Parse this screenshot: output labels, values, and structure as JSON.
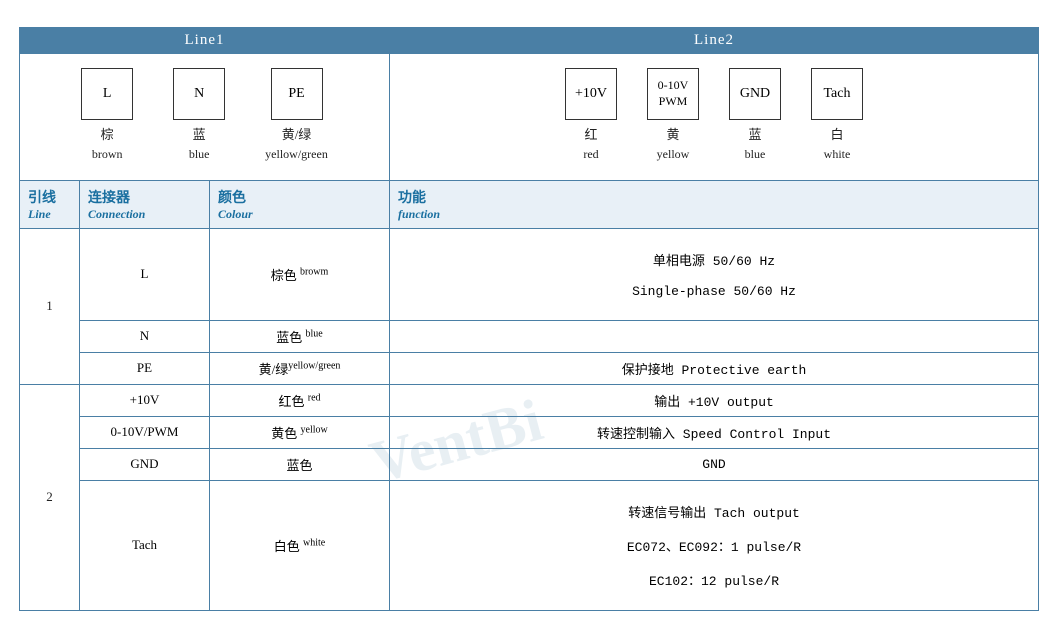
{
  "header": {
    "line1_label": "Line1",
    "line2_label": "Line2"
  },
  "diagram": {
    "line1": [
      {
        "symbol": "L",
        "cn": "棕",
        "en": "brown"
      },
      {
        "symbol": "N",
        "cn": "蓝",
        "en": "blue"
      },
      {
        "symbol": "PE",
        "cn": "黄/绿",
        "en": "yellow/green"
      }
    ],
    "line2": [
      {
        "symbol": "+10V",
        "cn": "红",
        "en": "red"
      },
      {
        "symbol_line1": "0-10V",
        "symbol_line2": "PWM",
        "cn": "黄",
        "en": "yellow"
      },
      {
        "symbol": "GND",
        "cn": "蓝",
        "en": "blue"
      },
      {
        "symbol": "Tach",
        "cn": "白",
        "en": "white"
      }
    ]
  },
  "col_headers": {
    "line_cn": "引线",
    "line_en": "Line",
    "connection_cn": "连接器",
    "connection_en": "Connection",
    "colour_cn": "颜色",
    "colour_en": "Colour",
    "function_cn": "功能",
    "function_en": "function"
  },
  "rows": [
    {
      "line": "1",
      "rowspan": 3,
      "items": [
        {
          "connection": "L",
          "colour_cn": "棕色",
          "colour_en": "browm",
          "function": "单相电源 50/60 Hz\nSingle-phase 50/60 Hz"
        },
        {
          "connection": "N",
          "colour_cn": "蓝色",
          "colour_en": "blue",
          "function": ""
        },
        {
          "connection": "PE",
          "colour_cn": "黄/绿",
          "colour_en": "yellow/green",
          "function": "保护接地 Protective earth"
        }
      ]
    },
    {
      "line": "2",
      "rowspan": 4,
      "items": [
        {
          "connection": "+10V",
          "colour_cn": "红色",
          "colour_en": "red",
          "function": "输出 +10V output"
        },
        {
          "connection": "0-10V/PWM",
          "colour_cn": "黄色",
          "colour_en": "yellow",
          "function": "转速控制输入 Speed Control Input"
        },
        {
          "connection": "GND",
          "colour_cn": "蓝色",
          "colour_en": "",
          "function": "GND"
        },
        {
          "connection": "Tach",
          "colour_cn": "白色",
          "colour_en": "white",
          "function": "转速信号输出 Tach output\nEC072、EC092：1 pulse/R\nEC102：12 pulse/R"
        }
      ]
    }
  ]
}
